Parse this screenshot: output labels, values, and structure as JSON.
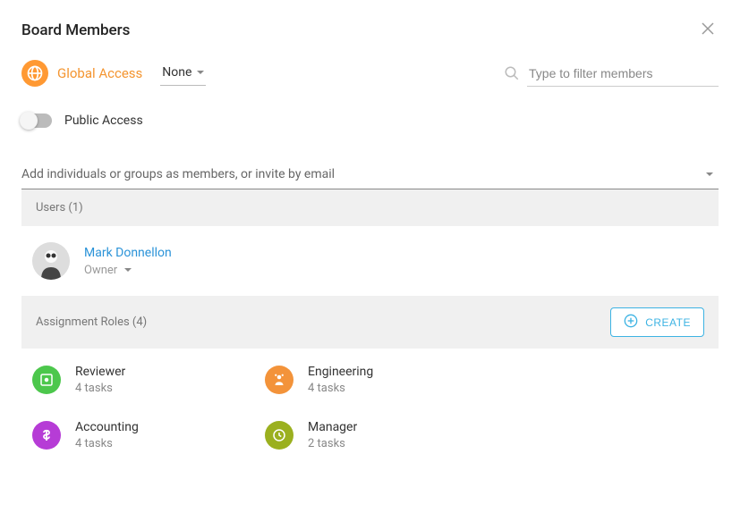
{
  "title": "Board Members",
  "globalAccess": {
    "label": "Global Access",
    "selectValue": "None"
  },
  "search": {
    "placeholder": "Type to filter members"
  },
  "publicAccess": {
    "label": "Public Access"
  },
  "addMembers": {
    "placeholder": "Add individuals or groups as members, or invite by email"
  },
  "usersSection": {
    "header": "Users (1)"
  },
  "user": {
    "name": "Mark Donnellon",
    "role": "Owner"
  },
  "rolesSection": {
    "header": "Assignment Roles (4)",
    "createLabel": "CREATE"
  },
  "roles": [
    {
      "name": "Reviewer",
      "tasks": "4 tasks",
      "color": "c-green"
    },
    {
      "name": "Engineering",
      "tasks": "4 tasks",
      "color": "c-orange"
    },
    {
      "name": "Accounting",
      "tasks": "4 tasks",
      "color": "c-purple"
    },
    {
      "name": "Manager",
      "tasks": "2 tasks",
      "color": "c-olive"
    }
  ]
}
